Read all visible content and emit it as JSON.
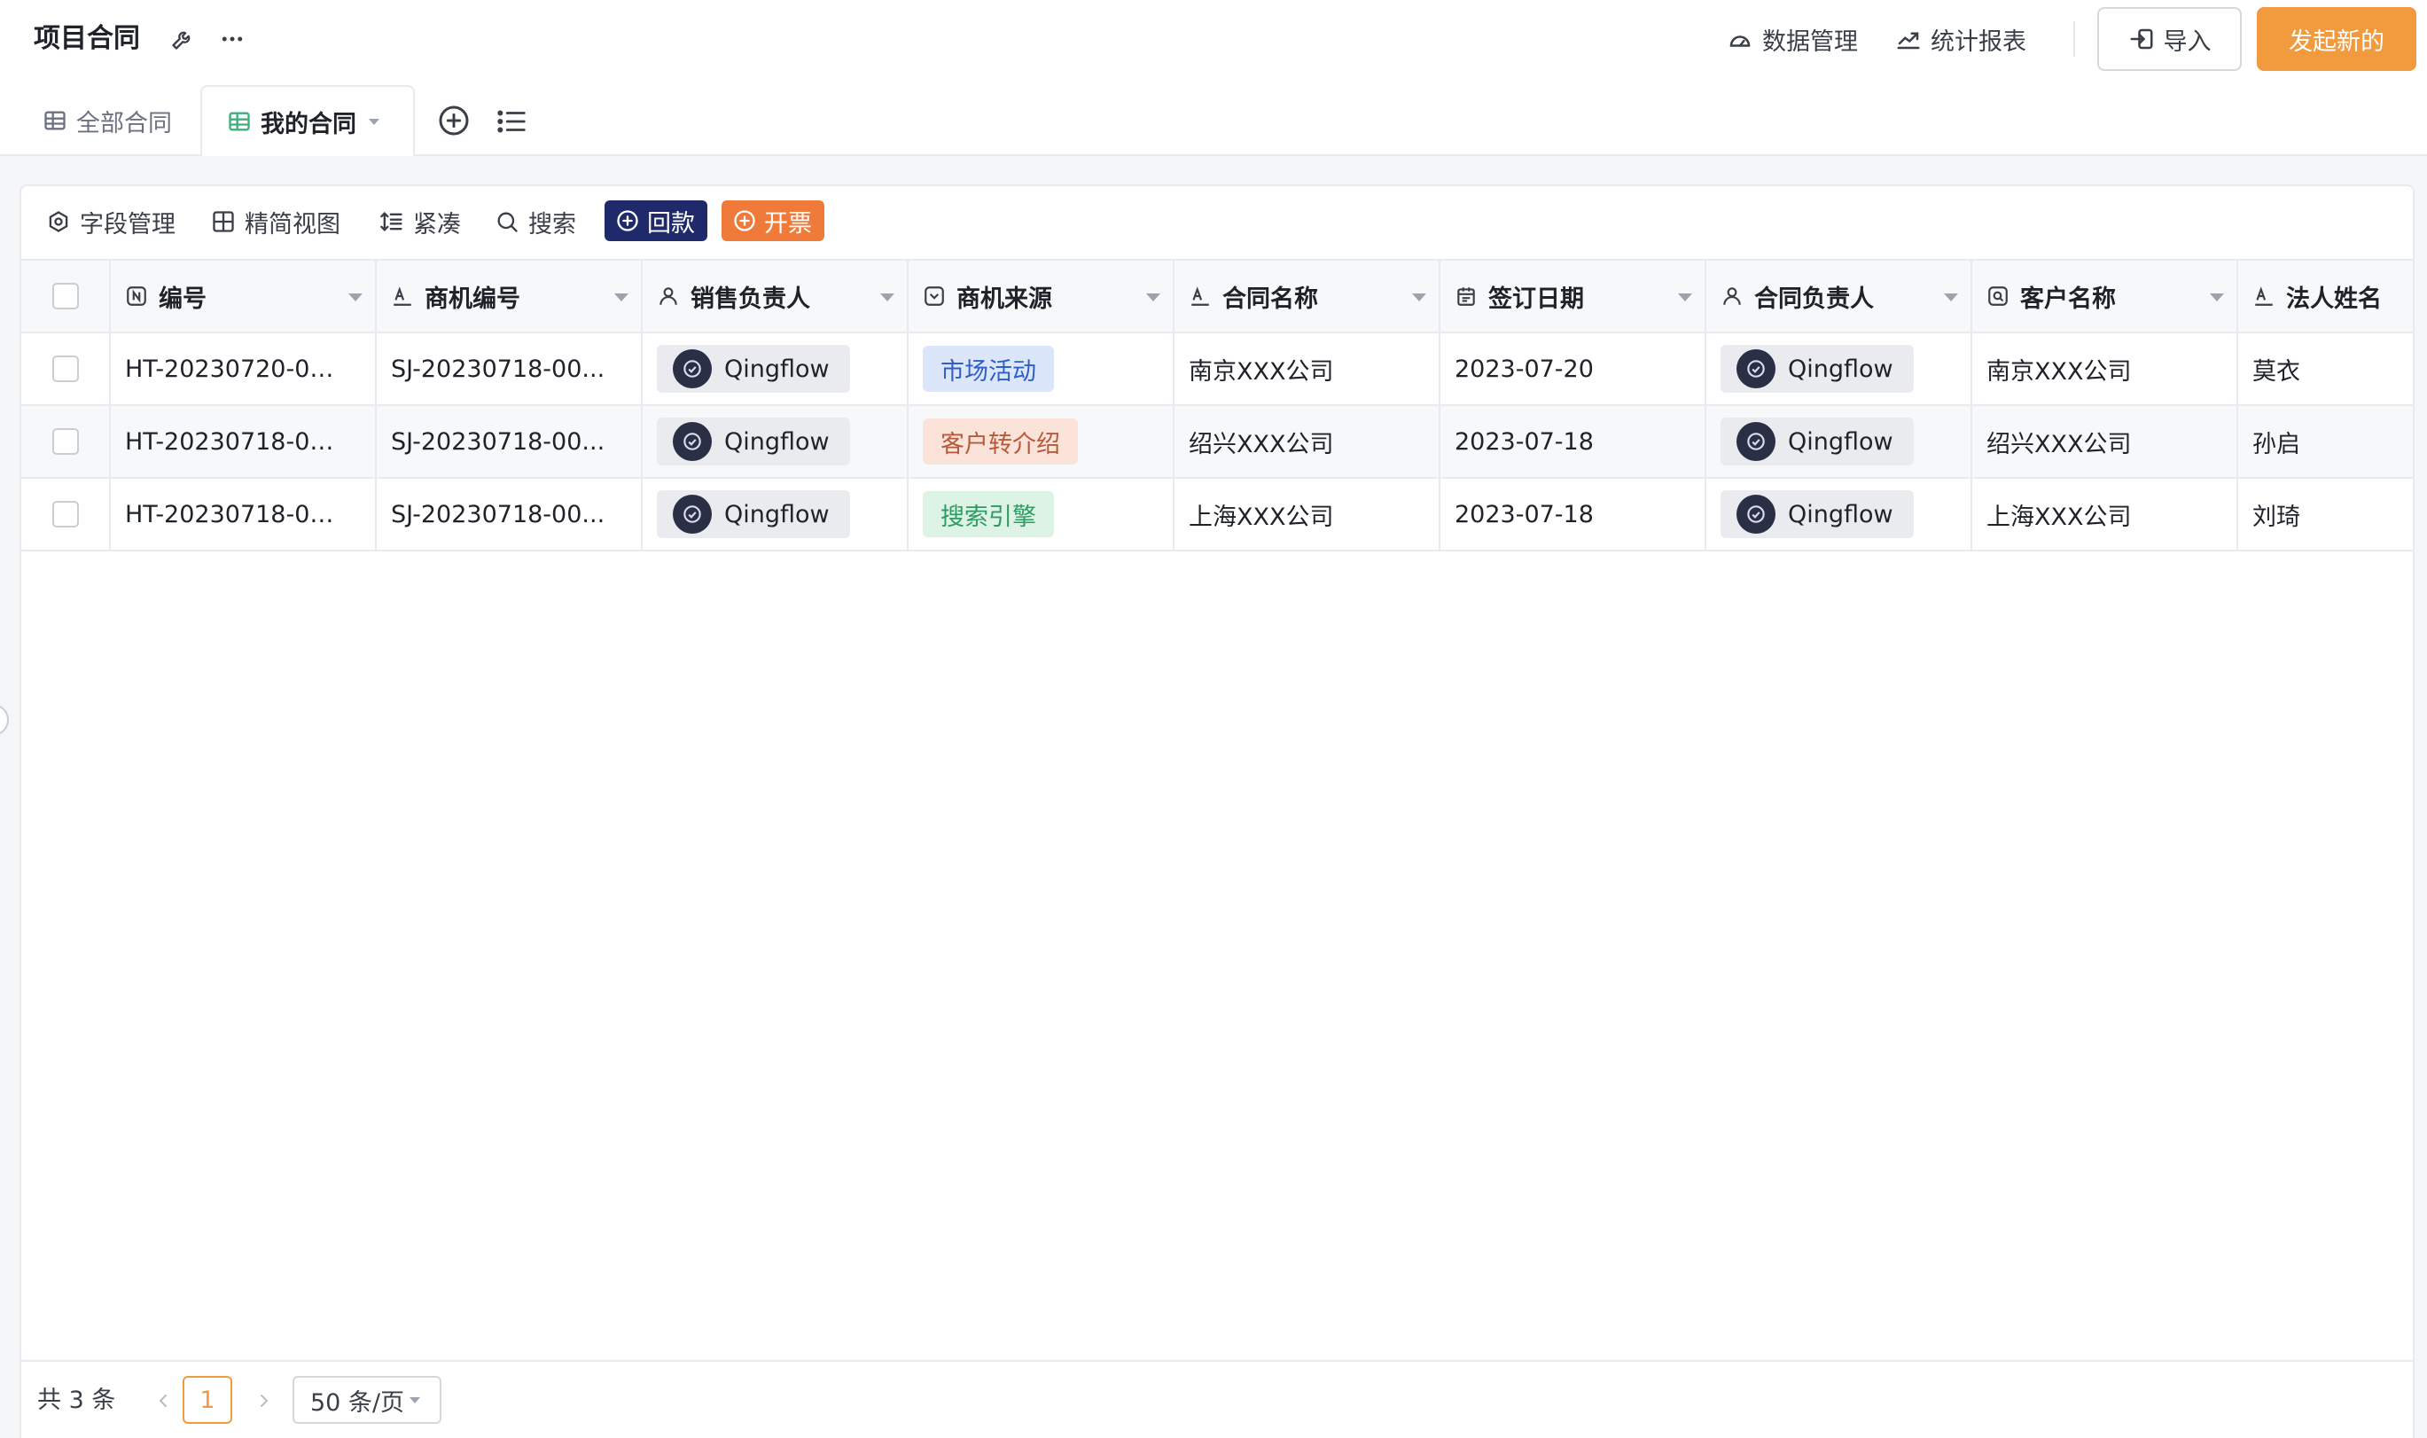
{
  "header": {
    "title": "项目合同",
    "data_mgmt_label": "数据管理",
    "report_label": "统计报表",
    "import_label": "导入",
    "create_label": "发起新的"
  },
  "tabs": [
    {
      "label": "全部合同",
      "active": false
    },
    {
      "label": "我的合同",
      "active": true
    }
  ],
  "toolbar": {
    "field_mgmt": "字段管理",
    "simple_view": "精简视图",
    "compact": "紧凑",
    "search": "搜索",
    "refund": "回款",
    "invoice": "开票"
  },
  "table": {
    "columns": [
      "编号",
      "商机编号",
      "销售负责人",
      "商机来源",
      "合同名称",
      "签订日期",
      "合同负责人",
      "客户名称",
      "法人姓名"
    ],
    "rows": [
      {
        "id": "HT-20230720-00...",
        "opp_id": "SJ-20230718-00...",
        "sales_owner": "Qingflow",
        "source": "市场活动",
        "contract_name": "南京XXX公司",
        "sign_date": "2023-07-20",
        "contract_owner": "Qingflow",
        "customer": "南京XXX公司",
        "legal_person": "莫衣"
      },
      {
        "id": "HT-20230718-00...",
        "opp_id": "SJ-20230718-00...",
        "sales_owner": "Qingflow",
        "source": "客户转介绍",
        "contract_name": "绍兴XXX公司",
        "sign_date": "2023-07-18",
        "contract_owner": "Qingflow",
        "customer": "绍兴XXX公司",
        "legal_person": "孙启"
      },
      {
        "id": "HT-20230718-00...",
        "opp_id": "SJ-20230718-00...",
        "sales_owner": "Qingflow",
        "source": "搜索引擎",
        "contract_name": "上海XXX公司",
        "sign_date": "2023-07-18",
        "contract_owner": "Qingflow",
        "customer": "上海XXX公司",
        "legal_person": "刘琦"
      }
    ]
  },
  "pagination": {
    "total_text": "共 3 条",
    "current_page": "1",
    "page_size": "50 条/页"
  },
  "colors": {
    "accent": "#f19a3e",
    "refund_btn": "#1f2a6b",
    "invoice_btn": "#ef7a3a",
    "tag_market": "#dce6fb",
    "tag_referral": "#fbe3da",
    "tag_search": "#dcf3e6"
  }
}
